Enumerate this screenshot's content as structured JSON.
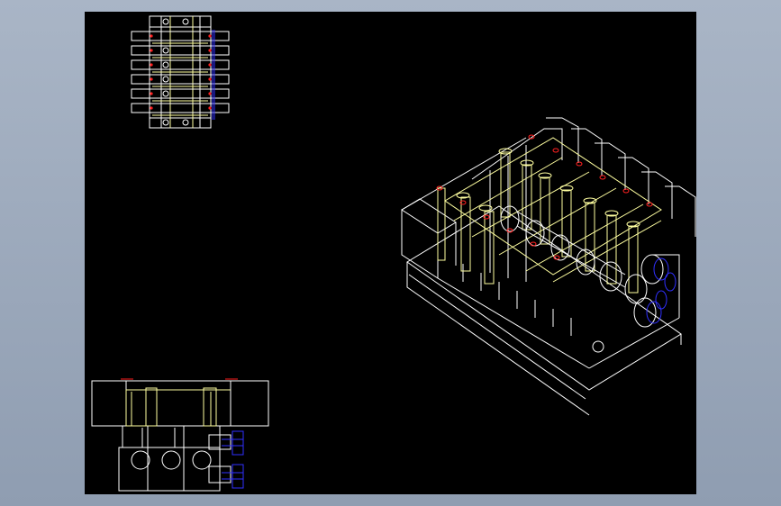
{
  "viewer": {
    "background_color": "#000000",
    "colors": {
      "outline": "#ffffff",
      "highlight": "#ffffa0",
      "marker": "#ff2020",
      "detail": "#3030ff"
    },
    "views": [
      "top-view",
      "isometric-view",
      "front-view"
    ]
  }
}
